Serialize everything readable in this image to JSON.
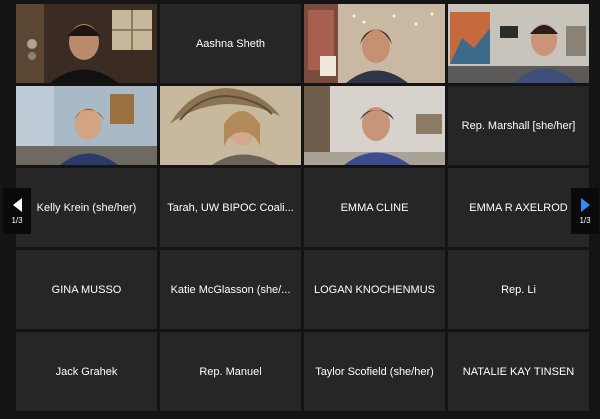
{
  "gallery": {
    "tiles": [
      {
        "name": ""
      },
      {
        "name": "Aashna Sheth"
      },
      {
        "name": ""
      },
      {
        "name": ""
      },
      {
        "name": ""
      },
      {
        "name": ""
      },
      {
        "name": ""
      },
      {
        "name": "Rep. Marshall [she/her]"
      },
      {
        "name": "Kelly Krein (she/her)"
      },
      {
        "name": "Tarah, UW BIPOC Coali..."
      },
      {
        "name": "EMMA CLINE"
      },
      {
        "name": "EMMA R AXELROD"
      },
      {
        "name": "GINA MUSSO"
      },
      {
        "name": "Katie McGlasson (she/..."
      },
      {
        "name": "LOGAN KNOCHENMUS"
      },
      {
        "name": "Rep. Li"
      },
      {
        "name": "Jack Grahek"
      },
      {
        "name": "Rep. Manuel"
      },
      {
        "name": "Taylor Scofield (she/her)"
      },
      {
        "name": "NATALIE KAY TINSEN"
      }
    ]
  },
  "pager": {
    "prev_page": "1/3",
    "next_page": "1/3",
    "next_color": "#2f8cff"
  },
  "active_speaker_color": "#a8d63a"
}
